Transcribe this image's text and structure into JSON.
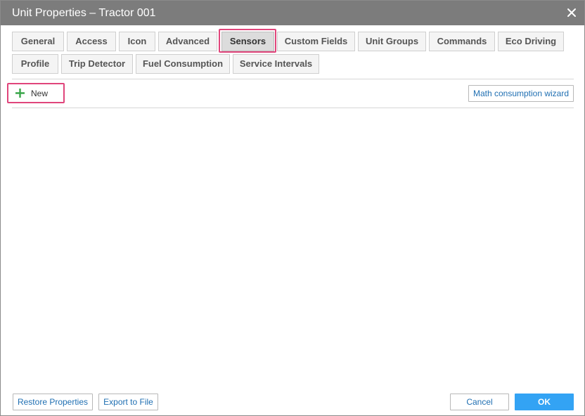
{
  "window": {
    "title": "Unit Properties – Tractor 001",
    "close_icon": "close-icon"
  },
  "tabs": [
    {
      "label": "General"
    },
    {
      "label": "Access"
    },
    {
      "label": "Icon"
    },
    {
      "label": "Advanced"
    },
    {
      "label": "Sensors",
      "active": true
    },
    {
      "label": "Custom Fields"
    },
    {
      "label": "Unit Groups"
    },
    {
      "label": "Commands"
    },
    {
      "label": "Eco Driving"
    },
    {
      "label": "Profile"
    },
    {
      "label": "Trip Detector"
    },
    {
      "label": "Fuel Consumption"
    },
    {
      "label": "Service Intervals"
    }
  ],
  "toolbar": {
    "new_label": "New",
    "new_icon": "plus-icon",
    "wizard_label": "Math consumption wizard"
  },
  "footer": {
    "restore_label": "Restore Properties",
    "export_label": "Export to File",
    "cancel_label": "Cancel",
    "ok_label": "OK"
  },
  "colors": {
    "titlebar": "#7c7c7c",
    "highlight": "#e0457b",
    "link": "#1f6fb2",
    "ok_button": "#33a3f4",
    "plus_icon": "#3aa64a"
  }
}
